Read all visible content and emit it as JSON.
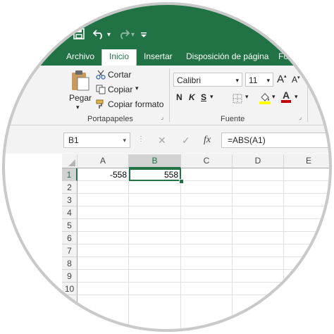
{
  "quick_access": {
    "redo_menu": "▾"
  },
  "tabs": [
    "Archivo",
    "Inicio",
    "Insertar",
    "Disposición de página",
    "Fó"
  ],
  "clipboard": {
    "paste": "Pegar",
    "cut": "Cortar",
    "copy": "Copiar",
    "format_painter": "Copiar formato",
    "group_label": "Portapapeles"
  },
  "font": {
    "name": "Calibri",
    "size": "11",
    "bold": "N",
    "italic": "K",
    "underline": "S",
    "grow": "A",
    "shrink": "A",
    "group_label": "Fuente"
  },
  "formula_bar": {
    "name_box": "B1",
    "cancel": "✕",
    "enter": "✓",
    "fx": "fx",
    "formula": "=ABS(A1)"
  },
  "sheet": {
    "columns": [
      "A",
      "B",
      "C",
      "D",
      "E"
    ],
    "rows": [
      "1",
      "2",
      "3",
      "4",
      "5",
      "6",
      "7",
      "8",
      "9",
      "10"
    ],
    "cells": {
      "A1": "-558",
      "B1": "558"
    },
    "selected": "B1"
  },
  "colors": {
    "accent": "#217346",
    "font_color": "#c00000",
    "highlight": "#ffff00"
  }
}
